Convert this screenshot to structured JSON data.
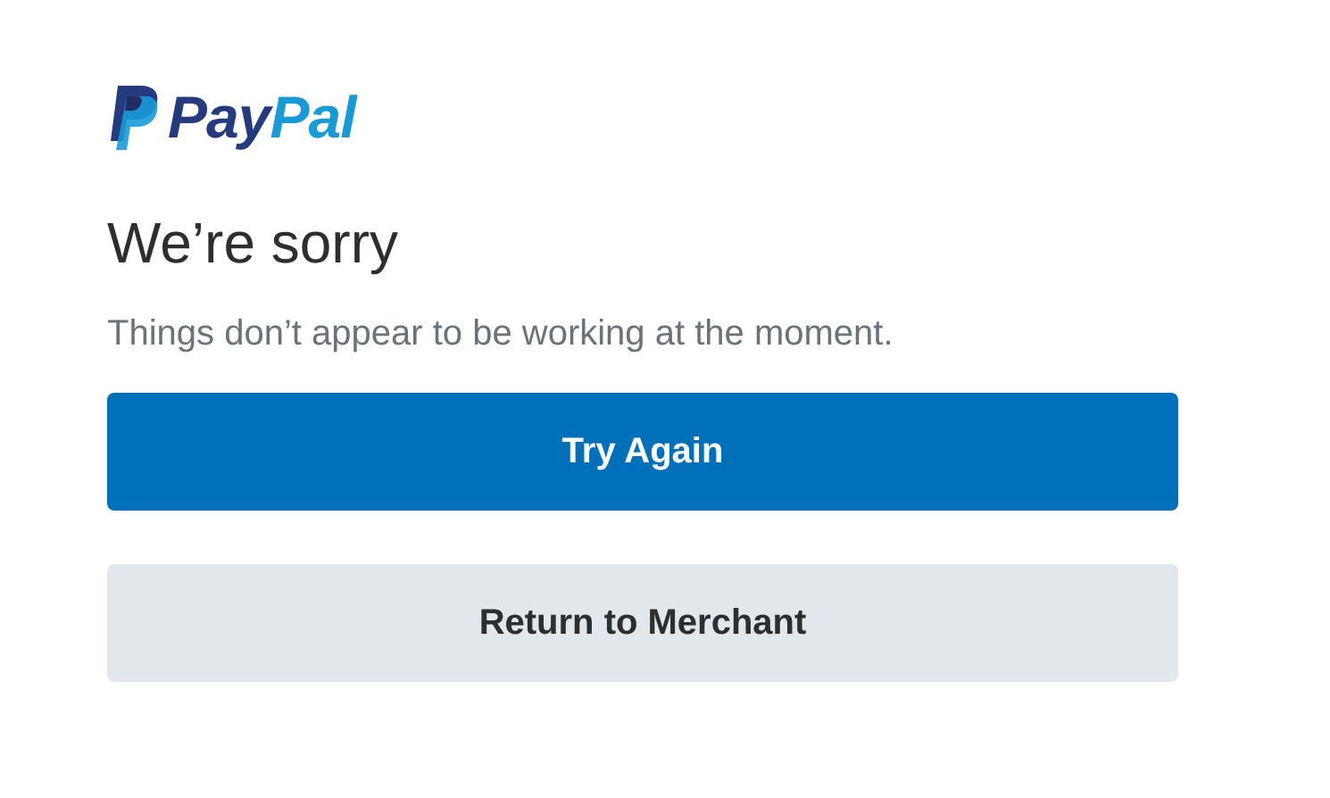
{
  "logo": {
    "parts": [
      {
        "text": "Pay",
        "color": "#253b80"
      },
      {
        "text": "Pal",
        "color": "#179bd7"
      }
    ]
  },
  "title": "We’re sorry",
  "message": "Things don’t appear to be working at the moment.",
  "buttons": [
    {
      "label": "Try Again",
      "kind": "primary"
    },
    {
      "label": "Return to Merchant",
      "kind": "secondary"
    }
  ]
}
